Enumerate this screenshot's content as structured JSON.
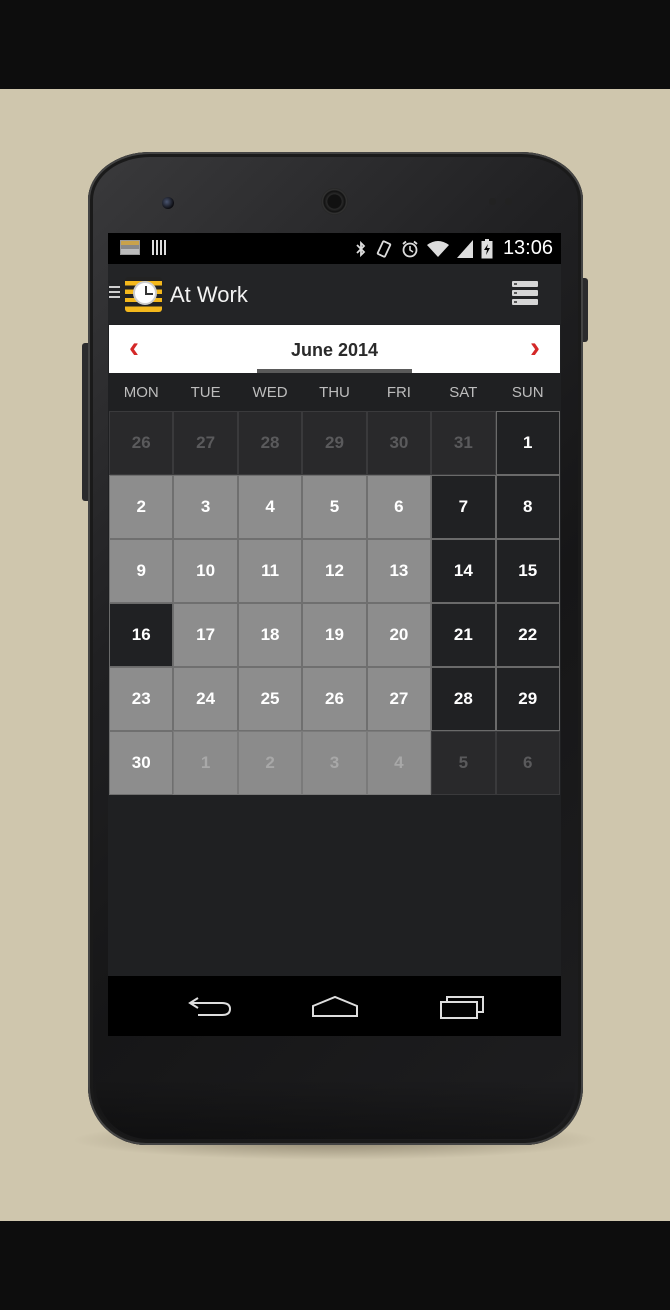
{
  "statusbar": {
    "time": "13:06",
    "icons": [
      "notification-icon",
      "barcode-icon",
      "bluetooth-icon",
      "rotate-icon",
      "alarm-icon",
      "wifi-icon",
      "signal-icon",
      "battery-icon"
    ]
  },
  "appbar": {
    "title": "At Work",
    "icons": [
      "menu-icon",
      "app-clock-icon",
      "list-view-icon"
    ]
  },
  "calendar": {
    "month": "June 2014",
    "prev_icon": "‹",
    "next_icon": "›",
    "accent_color": "#d42828",
    "weekdays": [
      "MON",
      "TUE",
      "WED",
      "THU",
      "FRI",
      "SAT",
      "SUN"
    ],
    "days": [
      {
        "label": "26",
        "type": "out"
      },
      {
        "label": "27",
        "type": "out"
      },
      {
        "label": "28",
        "type": "out"
      },
      {
        "label": "29",
        "type": "out"
      },
      {
        "label": "30",
        "type": "out"
      },
      {
        "label": "31",
        "type": "out"
      },
      {
        "label": "1",
        "type": "off"
      },
      {
        "label": "2",
        "type": "work"
      },
      {
        "label": "3",
        "type": "work"
      },
      {
        "label": "4",
        "type": "work"
      },
      {
        "label": "5",
        "type": "work"
      },
      {
        "label": "6",
        "type": "work"
      },
      {
        "label": "7",
        "type": "off"
      },
      {
        "label": "8",
        "type": "off"
      },
      {
        "label": "9",
        "type": "work"
      },
      {
        "label": "10",
        "type": "work"
      },
      {
        "label": "11",
        "type": "work"
      },
      {
        "label": "12",
        "type": "work"
      },
      {
        "label": "13",
        "type": "work"
      },
      {
        "label": "14",
        "type": "off"
      },
      {
        "label": "15",
        "type": "off"
      },
      {
        "label": "16",
        "type": "off"
      },
      {
        "label": "17",
        "type": "work"
      },
      {
        "label": "18",
        "type": "work"
      },
      {
        "label": "19",
        "type": "work"
      },
      {
        "label": "20",
        "type": "work"
      },
      {
        "label": "21",
        "type": "off"
      },
      {
        "label": "22",
        "type": "off"
      },
      {
        "label": "23",
        "type": "work"
      },
      {
        "label": "24",
        "type": "work"
      },
      {
        "label": "25",
        "type": "work"
      },
      {
        "label": "26",
        "type": "work"
      },
      {
        "label": "27",
        "type": "work"
      },
      {
        "label": "28",
        "type": "off"
      },
      {
        "label": "29",
        "type": "off"
      },
      {
        "label": "30",
        "type": "work"
      },
      {
        "label": "1",
        "type": "outg"
      },
      {
        "label": "2",
        "type": "outg"
      },
      {
        "label": "3",
        "type": "outg"
      },
      {
        "label": "4",
        "type": "outg"
      },
      {
        "label": "5",
        "type": "out"
      },
      {
        "label": "6",
        "type": "out"
      }
    ]
  },
  "navbar": {
    "icons": [
      "back-icon",
      "home-icon",
      "recent-apps-icon"
    ]
  }
}
